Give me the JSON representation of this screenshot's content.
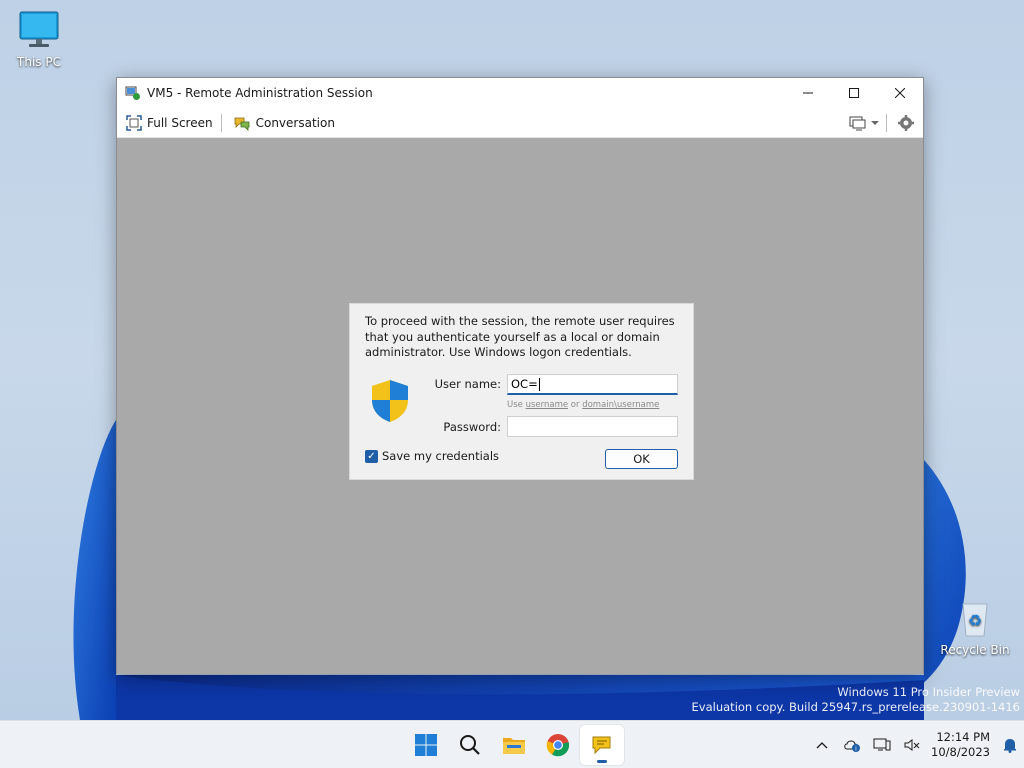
{
  "desktop": {
    "icons": [
      {
        "label": "This PC",
        "icon": "monitor-icon"
      },
      {
        "label": "Recycle Bin",
        "icon": "recycle-bin-icon"
      }
    ],
    "watermark": {
      "line1": "Windows 11 Pro Insider Preview",
      "line2": "Evaluation copy. Build 25947.rs_prerelease.230901-1416"
    }
  },
  "window": {
    "title": "VM5 - Remote Administration Session",
    "controls": {
      "minimize": "—",
      "maximize": "☐",
      "close": "✕"
    },
    "toolbar": {
      "full_screen_label": "Full Screen",
      "conversation_label": "Conversation"
    }
  },
  "dialog": {
    "message": "To proceed with the session, the remote user requires that you authenticate yourself as a local or domain administrator. Use Windows logon credentials.",
    "username_label": "User name:",
    "username_value": "OC=",
    "hint_prefix": "Use ",
    "hint_username": "username",
    "hint_or": " or ",
    "hint_domain": "domain\\username",
    "password_label": "Password:",
    "password_value": "",
    "save_credentials_label": "Save my credentials",
    "save_credentials_checked": true,
    "ok_label": "OK"
  },
  "taskbar": {
    "apps": [
      "windows-start-icon",
      "search-icon",
      "file-explorer-icon",
      "chrome-icon",
      "remote-admin-app-icon"
    ],
    "clock": {
      "time": "12:14 PM",
      "date": "10/8/2023"
    }
  },
  "colors": {
    "accent": "#1f5fa8",
    "viewport": "#a9a9a9",
    "taskbar": "#eef1f6"
  }
}
